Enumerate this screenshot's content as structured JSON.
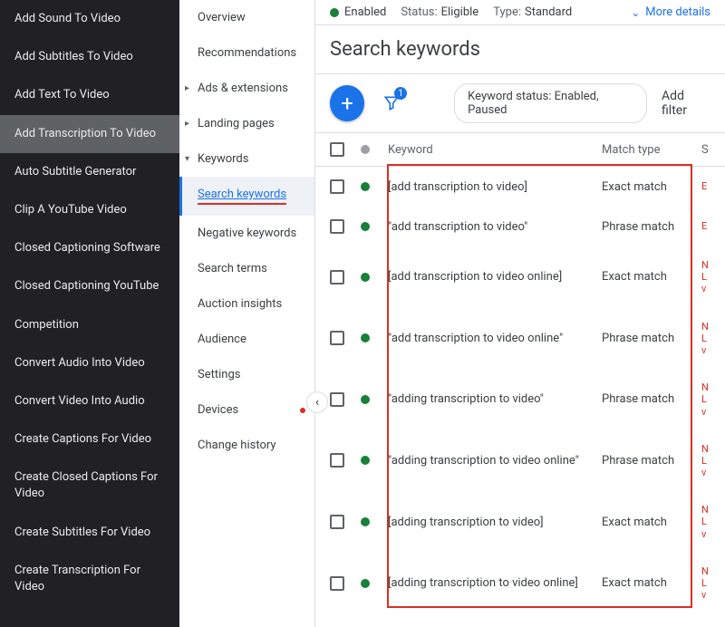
{
  "sidebar_dark": {
    "items": [
      {
        "label": "Add Sound To Video"
      },
      {
        "label": "Add Subtitles To Video"
      },
      {
        "label": "Add Text To Video"
      },
      {
        "label": "Add Transcription To Video",
        "selected": true
      },
      {
        "label": "Auto Subtitle Generator"
      },
      {
        "label": "Clip A YouTube Video"
      },
      {
        "label": "Closed Captioning Software"
      },
      {
        "label": "Closed Captioning YouTube"
      },
      {
        "label": "Competition"
      },
      {
        "label": "Convert Audio Into Video"
      },
      {
        "label": "Convert Video Into Audio"
      },
      {
        "label": "Create Captions For Video"
      },
      {
        "label": "Create Closed Captions For Video"
      },
      {
        "label": "Create Subtitles For Video"
      },
      {
        "label": "Create Transcription For Video"
      }
    ]
  },
  "sidebar_light": {
    "items": [
      {
        "label": "Overview"
      },
      {
        "label": "Recommendations"
      },
      {
        "label": "Ads & extensions",
        "expandable": true
      },
      {
        "label": "Landing pages",
        "expandable": true
      },
      {
        "label": "Keywords",
        "expandable": true,
        "expanded": true
      },
      {
        "label": "Search keywords",
        "selected": true,
        "indent": true
      },
      {
        "label": "Negative keywords",
        "indent": true
      },
      {
        "label": "Search terms",
        "indent": true
      },
      {
        "label": "Auction insights",
        "indent": true
      },
      {
        "label": "Audience"
      },
      {
        "label": "Settings"
      },
      {
        "label": "Devices",
        "red_dot": true
      },
      {
        "label": "Change history"
      }
    ]
  },
  "statusbar": {
    "enabled": "Enabled",
    "status_label": "Status:",
    "status_value": "Eligible",
    "type_label": "Type:",
    "type_value": "Standard",
    "more": "More details"
  },
  "page_title": "Search keywords",
  "toolbar": {
    "filter_count": "1",
    "chip_label": "Keyword status: Enabled, Paused",
    "add_filter": "Add filter"
  },
  "table": {
    "headers": {
      "keyword": "Keyword",
      "match": "Match type",
      "last": "S"
    },
    "rows": [
      {
        "keyword": "[add transcription to video]",
        "match": "Exact match",
        "red": "E"
      },
      {
        "keyword": "\"add transcription to video\"",
        "match": "Phrase match",
        "red": "E"
      },
      {
        "keyword": "[add transcription to video online]",
        "match": "Exact match",
        "red": "N\nL\nv"
      },
      {
        "keyword": "\"add transcription to video online\"",
        "match": "Phrase match",
        "red": "N\nL\nv"
      },
      {
        "keyword": "\"adding transcription to video\"",
        "match": "Phrase match",
        "red": "N\nL\nv"
      },
      {
        "keyword": "\"adding transcription to video online\"",
        "match": "Phrase match",
        "red": "N\nL\nv"
      },
      {
        "keyword": "[adding transcription to video]",
        "match": "Exact match",
        "red": "N\nL\nv"
      },
      {
        "keyword": "[adding transcription to video online]",
        "match": "Exact match",
        "red": "N\nL\nv"
      }
    ]
  }
}
